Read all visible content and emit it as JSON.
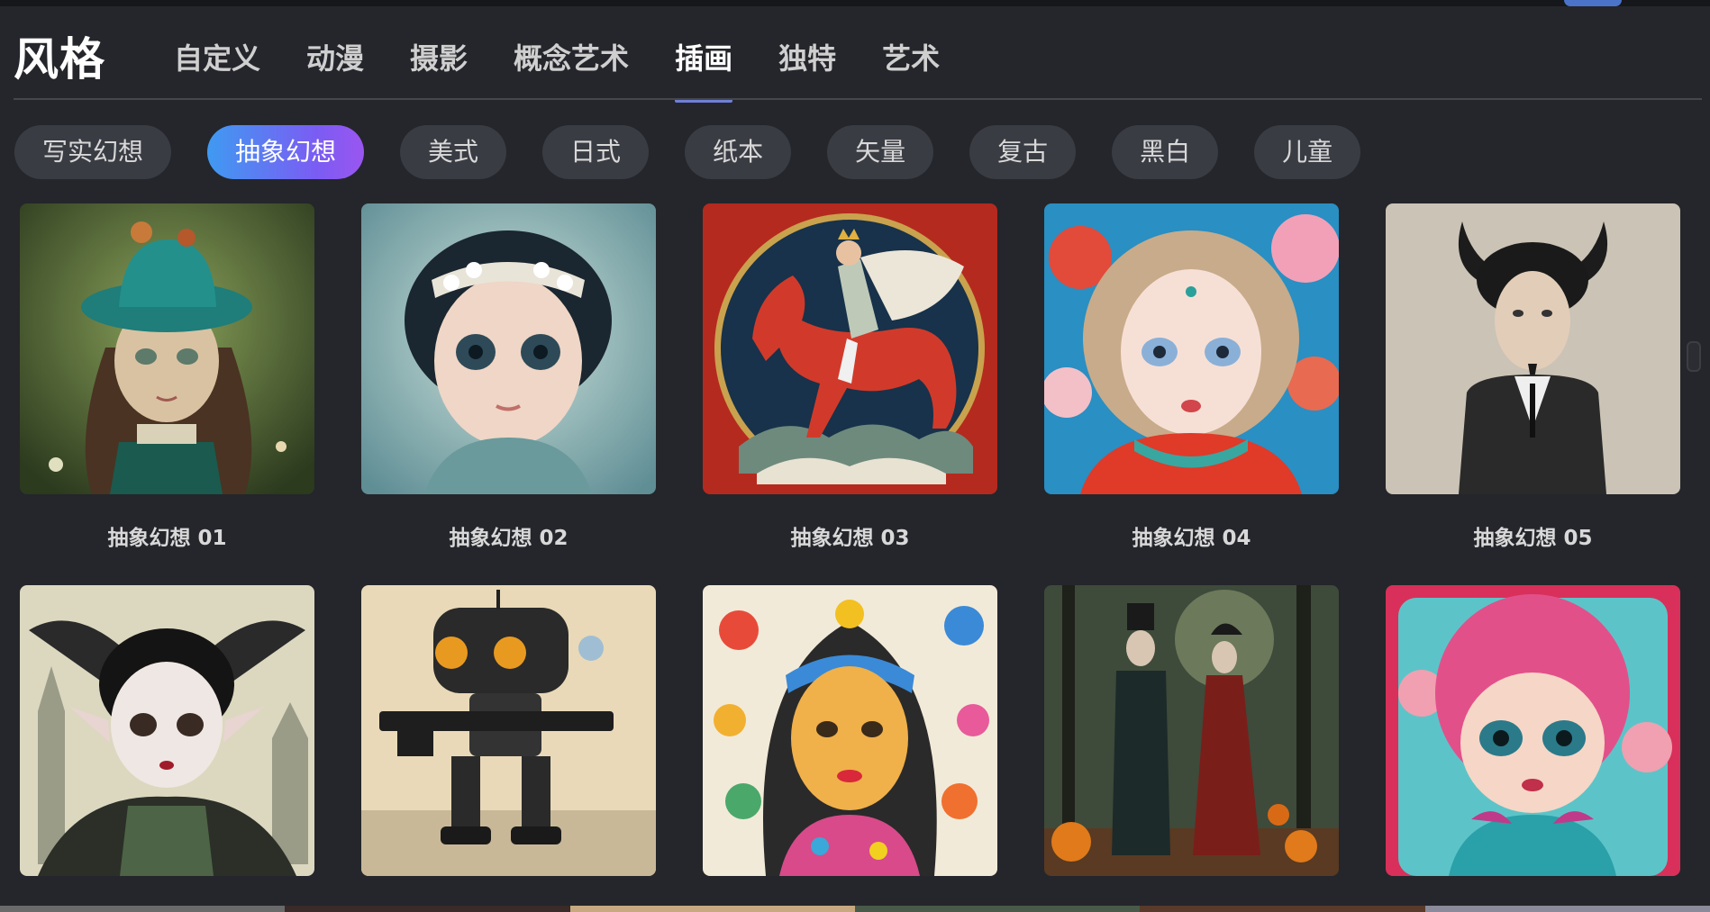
{
  "header": {
    "title": "风格",
    "tabs": [
      {
        "label": "自定义",
        "active": false
      },
      {
        "label": "动漫",
        "active": false
      },
      {
        "label": "摄影",
        "active": false
      },
      {
        "label": "概念艺术",
        "active": false
      },
      {
        "label": "插画",
        "active": true
      },
      {
        "label": "独特",
        "active": false
      },
      {
        "label": "艺术",
        "active": false
      }
    ]
  },
  "subcategories": [
    {
      "label": "写实幻想",
      "active": false
    },
    {
      "label": "抽象幻想",
      "active": true
    },
    {
      "label": "美式",
      "active": false
    },
    {
      "label": "日式",
      "active": false
    },
    {
      "label": "纸本",
      "active": false
    },
    {
      "label": "矢量",
      "active": false
    },
    {
      "label": "复古",
      "active": false
    },
    {
      "label": "黑白",
      "active": false
    },
    {
      "label": "儿童",
      "active": false
    }
  ],
  "styles": [
    {
      "caption": "抽象幻想 01",
      "image": "girl-with-teal-hat-and-birds"
    },
    {
      "caption": "抽象幻想 02",
      "image": "girl-with-daisy-headband"
    },
    {
      "caption": "抽象幻想 03",
      "image": "rider-on-red-horse"
    },
    {
      "caption": "抽象幻想 04",
      "image": "blonde-girl-with-flowers"
    },
    {
      "caption": "抽象幻想 05",
      "image": "horned-young-man"
    },
    {
      "caption": "",
      "image": "bat-winged-girl"
    },
    {
      "caption": "",
      "image": "robot-with-gun"
    },
    {
      "caption": "",
      "image": "colorful-folk-girl"
    },
    {
      "caption": "",
      "image": "gothic-couple-in-forest"
    },
    {
      "caption": "",
      "image": "pink-haired-doll-girl"
    }
  ],
  "colors": {
    "background": "#24262b",
    "chip": "#3a3c44",
    "accent_start": "#3f9af2",
    "accent_end": "#9a56f0",
    "tab_underline": "#6f7fd8"
  }
}
